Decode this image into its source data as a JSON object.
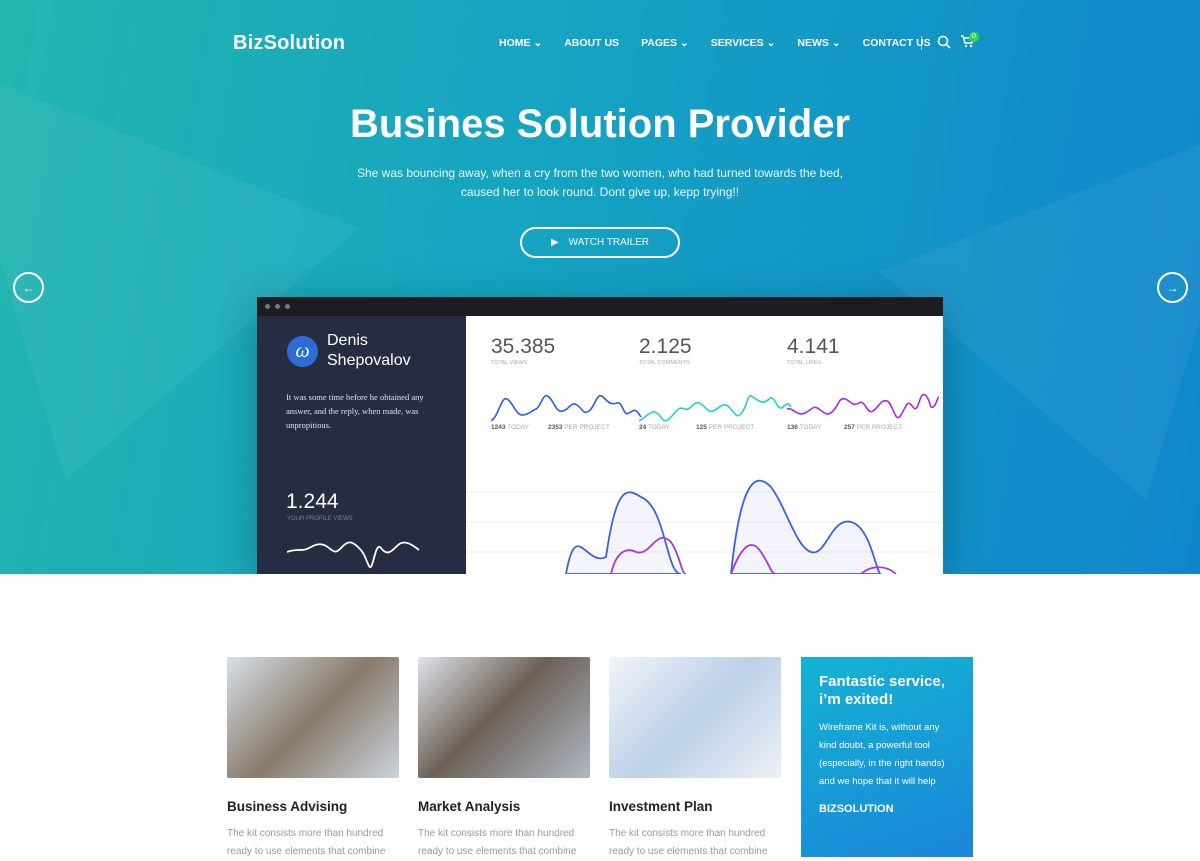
{
  "brand": "BizSolution",
  "nav": [
    {
      "label": "HOME",
      "dropdown": true
    },
    {
      "label": "ABOUT US",
      "dropdown": false
    },
    {
      "label": "PAGES",
      "dropdown": true
    },
    {
      "label": "SERVICES",
      "dropdown": true
    },
    {
      "label": "NEWS",
      "dropdown": true
    },
    {
      "label": "CONTACT US",
      "dropdown": false
    }
  ],
  "cart_count": "0",
  "hero": {
    "title": "Busines Solution Provider",
    "subtitle": "She was bouncing away, when a cry from the two women, who had turned towards the bed, caused her to look round. Dont give up, kepp trying!!",
    "button": "WATCH TRAILER"
  },
  "dashboard": {
    "user": "Denis Shepovalov",
    "quote": "It was some time before he obtained any answer, and the reply, when made, was unpropitious.",
    "profile_views": "1.244",
    "profile_views_label": "YOUR PROFILE VIEWS",
    "stats": [
      {
        "value": "35.385",
        "label": "TOTAL VIEWS",
        "today": "1243",
        "today_label": "TODAY",
        "per": "2353",
        "per_label": "PER PROJECT",
        "color": "#2a5fe0"
      },
      {
        "value": "2.125",
        "label": "TOTAL COMMENTS",
        "today": "24",
        "today_label": "TODAY",
        "per": "125",
        "per_label": "PER PROJECT",
        "color": "#1fd0d8"
      },
      {
        "value": "4.141",
        "label": "TOTAL LIKES",
        "today": "136",
        "today_label": "TODAY",
        "per": "257",
        "per_label": "PER PROJECT",
        "color": "#a42be0"
      }
    ]
  },
  "cards": [
    {
      "title": "Business Advising",
      "desc": "The kit consists more than hundred ready to use elements that combine"
    },
    {
      "title": "Market Analysis",
      "desc": "The kit consists more than hundred ready to use elements that combine"
    },
    {
      "title": "Investment Plan",
      "desc": "The kit consists more than hundred ready to use elements that combine"
    }
  ],
  "testimonial": {
    "heading": "Fantastic service, i’m exited!",
    "text": "Wireframe Kit is, without any kind doubt, a powerful tool (especially, in the right hands) and we hope that it will help",
    "author": "BIZSOLUTION"
  }
}
